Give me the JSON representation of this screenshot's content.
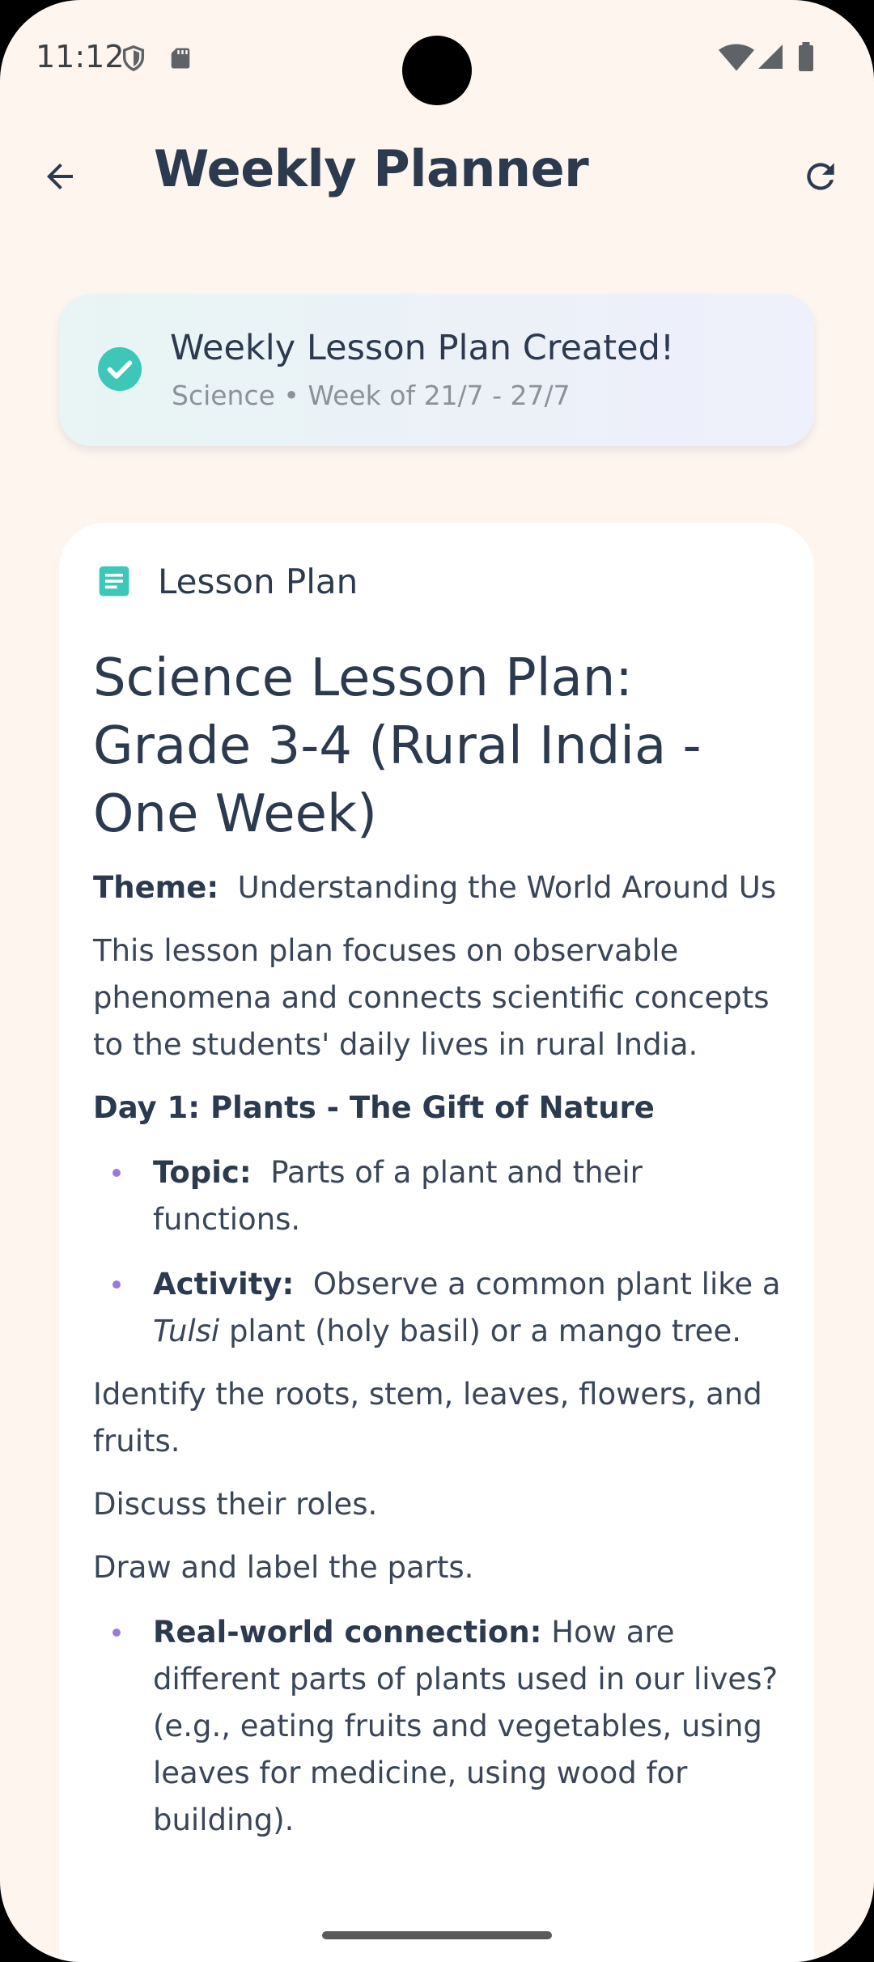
{
  "status_bar": {
    "time": "11:12",
    "icons": [
      "shield-icon",
      "sd-card-icon",
      "wifi-icon",
      "signal-icon",
      "battery-icon"
    ]
  },
  "app_bar": {
    "title": "Weekly Planner",
    "icons": [
      "back-arrow-icon",
      "refresh-icon"
    ]
  },
  "banner": {
    "title": "Weekly Lesson Plan Created!",
    "subtitle": "Science • Week of 21/7 - 27/7",
    "icon": "check-circle-icon",
    "accent": "#3cc7b9"
  },
  "card": {
    "label": "Lesson Plan",
    "icon": "document-icon",
    "plan_title": "Science Lesson Plan: Grade 3-4 (Rural India - One Week)",
    "theme_label": "Theme:",
    "theme_value": "Understanding the World Around Us",
    "intro": "This lesson plan focuses on observable phenomena and connects scientific concepts to the students' daily lives in rural India.",
    "day1": {
      "heading": "Day 1:  Plants - The Gift of Nature",
      "topic_label": "Topic:",
      "topic_value": "Parts of a plant and their functions.",
      "activity_label": "Activity:",
      "activity_value_pre": "Observe a common plant like a",
      "activity_italic": "Tulsi",
      "activity_value_post": "plant (holy basil) or a mango tree.",
      "para1": "Identify the roots, stem, leaves, flowers, and fruits.",
      "para2": "Discuss their roles.",
      "para3": "Draw and label the parts.",
      "connection_label": "Real-world connection:",
      "connection_value": "How are different parts of plants used in our lives? (e.g., eating fruits and vegetables, using leaves for medicine, using wood for building)."
    }
  },
  "colors": {
    "background": "#fdf5ee",
    "text_primary": "#2c3a4f",
    "bullet": "#9c7ad8",
    "teal": "#3cc7b9"
  }
}
